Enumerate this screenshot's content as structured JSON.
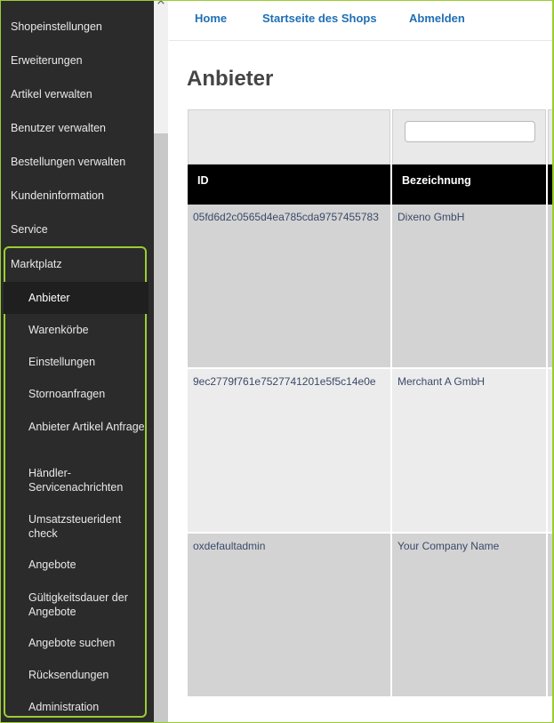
{
  "sidebar": {
    "items": [
      {
        "label": "Shopeinstellungen"
      },
      {
        "label": "Erweiterungen"
      },
      {
        "label": "Artikel verwalten"
      },
      {
        "label": "Benutzer verwalten"
      },
      {
        "label": "Bestellungen verwalten"
      },
      {
        "label": "Kundeninformation"
      },
      {
        "label": "Service"
      }
    ],
    "marketplace": {
      "label": "Marktplatz",
      "items": [
        {
          "label": "Anbieter"
        },
        {
          "label": "Warenkörbe"
        },
        {
          "label": "Einstellungen"
        },
        {
          "label": "Stornoanfragen"
        },
        {
          "label": "Anbieter Artikel Anfrage"
        },
        {
          "label": "Händler-Servicenachrichten"
        },
        {
          "label": "Umsatzsteuerident check"
        },
        {
          "label": "Angebote"
        },
        {
          "label": "Gültigkeitsdauer der Angebote"
        },
        {
          "label": "Angebote suchen"
        },
        {
          "label": "Rücksendungen"
        },
        {
          "label": "Administration"
        }
      ]
    }
  },
  "topnav": {
    "home": "Home",
    "shop_start": "Startseite des Shops",
    "logout": "Abmelden"
  },
  "page": {
    "title": "Anbieter"
  },
  "table": {
    "headers": {
      "id": "ID",
      "name": "Bezeichnung"
    },
    "filter_placeholder": "",
    "rows": [
      {
        "id": "05fd6d2c0565d4ea785cda9757455783",
        "name": "Dixeno GmbH"
      },
      {
        "id": "9ec2779f761e7527741201e5f5c14e0e",
        "name": "Merchant A GmbH"
      },
      {
        "id": "oxdefaultadmin",
        "name": "Your Company Name"
      }
    ]
  },
  "colors": {
    "accent": "#9acd32",
    "link": "#1f6fb5",
    "sidebar_bg": "#2b2b2b"
  }
}
